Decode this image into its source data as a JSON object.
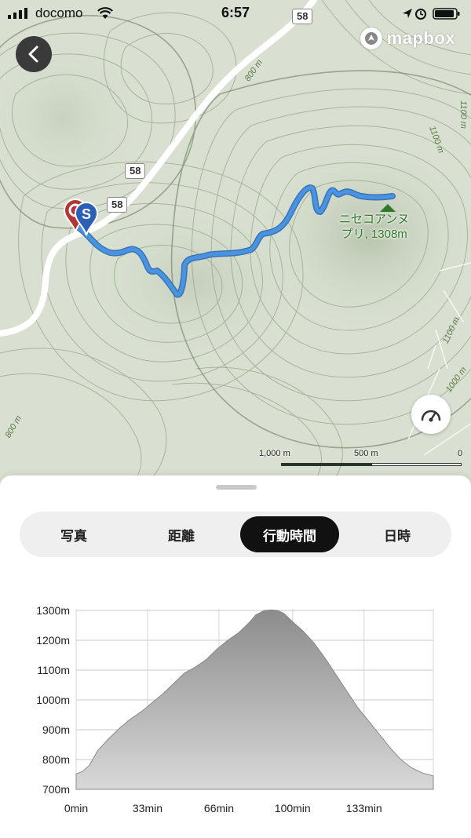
{
  "status_bar": {
    "carrier": "docomo",
    "time": "6:57"
  },
  "map": {
    "attribution": "mapbox",
    "road_signs": [
      "58",
      "58",
      "58"
    ],
    "summit_label_line1": "ニセコアンヌ",
    "summit_label_line2": "プリ, 1308m",
    "contour_labels": [
      "800 m",
      "1100 m",
      "1100 m",
      "1100 m",
      "1000 m",
      "800 m"
    ],
    "start_marker": "S",
    "scale": {
      "left": "1,000 m",
      "mid": "500 m",
      "right": "0"
    },
    "icons": [
      "back-icon",
      "speedometer-icon",
      "mapbox-logo-icon",
      "summit-flag-icon"
    ]
  },
  "tabs": [
    {
      "label": "写真",
      "active": false
    },
    {
      "label": "距離",
      "active": false
    },
    {
      "label": "行動時間",
      "active": true
    },
    {
      "label": "日時",
      "active": false
    }
  ],
  "chart_data": {
    "type": "area",
    "title": "",
    "xlabel": "",
    "ylabel": "",
    "x_ticks": [
      "0min",
      "33min",
      "66min",
      "100min",
      "133min"
    ],
    "y_ticks": [
      "700m",
      "800m",
      "900m",
      "1000m",
      "1100m",
      "1200m",
      "1300m"
    ],
    "xlim": [
      0,
      165
    ],
    "ylim": [
      700,
      1300
    ],
    "grid": true,
    "fill_color": "#9a9a9a",
    "series": [
      {
        "x": [
          0,
          3,
          6,
          10,
          15,
          20,
          25,
          30,
          35,
          40,
          45,
          50,
          55,
          60,
          65,
          70,
          75,
          80,
          83,
          87,
          90,
          93,
          96,
          100,
          105,
          110,
          115,
          120,
          125,
          130,
          135,
          140,
          145,
          150,
          155,
          160,
          165
        ],
        "values": [
          752,
          760,
          780,
          830,
          870,
          905,
          935,
          960,
          990,
          1020,
          1055,
          1090,
          1110,
          1135,
          1170,
          1200,
          1225,
          1260,
          1285,
          1300,
          1302,
          1300,
          1290,
          1262,
          1230,
          1190,
          1140,
          1085,
          1030,
          975,
          930,
          885,
          840,
          800,
          772,
          755,
          745
        ]
      }
    ]
  }
}
